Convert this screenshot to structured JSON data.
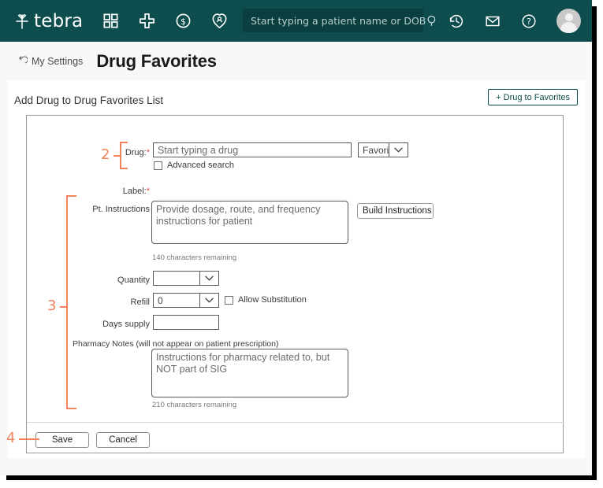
{
  "header": {
    "logo_text": "tebra",
    "logo_icon": "tebra-leaf-icon",
    "nav_icons": [
      {
        "name": "dashboard-grid-icon",
        "label": "Dashboard"
      },
      {
        "name": "add-plus-icon",
        "label": "Create"
      },
      {
        "name": "billing-dollar-icon",
        "label": "Billing"
      },
      {
        "name": "patients-heart-icon",
        "label": "Patients"
      }
    ],
    "search": {
      "placeholder": "Start typing a patient name or DOB",
      "value": "",
      "icon": "search-icon"
    },
    "right_icons": [
      {
        "name": "history-clock-icon",
        "label": "Recent"
      },
      {
        "name": "mail-envelope-icon",
        "label": "Messages"
      },
      {
        "name": "help-question-icon",
        "label": "Help"
      }
    ],
    "avatar": "user-avatar"
  },
  "titlebar": {
    "back_icon": "back-arrow-icon",
    "back_label": "My Settings",
    "page_title": "Drug Favorites"
  },
  "content": {
    "section_title": "Add Drug to Drug Favorites List",
    "add_button_label": "+ Drug to Favorites"
  },
  "form": {
    "drug": {
      "label": "Drug:",
      "required_mark": "*",
      "placeholder": "Start typing a drug",
      "value": ""
    },
    "favorites_select": {
      "value": "Favorites",
      "icon": "chevron-down-icon"
    },
    "advanced_search": {
      "label": "Advanced search",
      "checked": false
    },
    "label_field": {
      "label": "Label:",
      "required_mark": "*",
      "value": ""
    },
    "pt_instructions": {
      "label": "Pt. Instructions",
      "placeholder": "Provide dosage, route, and frequency instructions for patient",
      "value": "",
      "hint": "140 characters remaining"
    },
    "build_instructions_button": "Build Instructions",
    "quantity": {
      "label": "Quantity",
      "value": "",
      "icon": "chevron-down-icon"
    },
    "refill": {
      "label": "Refill",
      "value": "0",
      "icon": "chevron-down-icon"
    },
    "allow_substitution": {
      "label": "Allow Substitution",
      "checked": false
    },
    "days_supply": {
      "label": "Days supply",
      "value": ""
    },
    "pharmacy_notes": {
      "label": "Pharmacy Notes (will not appear on patient prescription)",
      "placeholder": "Instructions for pharmacy related to, but NOT part of SIG",
      "value": "",
      "hint": "210 characters remaining"
    },
    "save_button": "Save",
    "cancel_button": "Cancel"
  },
  "annotations": {
    "accent_color": "#f2845c",
    "markers": [
      {
        "number": "2",
        "target": "drug-field-group"
      },
      {
        "number": "3",
        "target": "prescription-details-group"
      },
      {
        "number": "4",
        "target": "save-button"
      }
    ]
  },
  "colors": {
    "header_bg": "#0d4d4d",
    "search_bg": "#0a3f40",
    "page_bg": "#f8f8f7",
    "card_bg": "#ffffff",
    "accent": "#f2845c",
    "required": "#d9534f"
  }
}
